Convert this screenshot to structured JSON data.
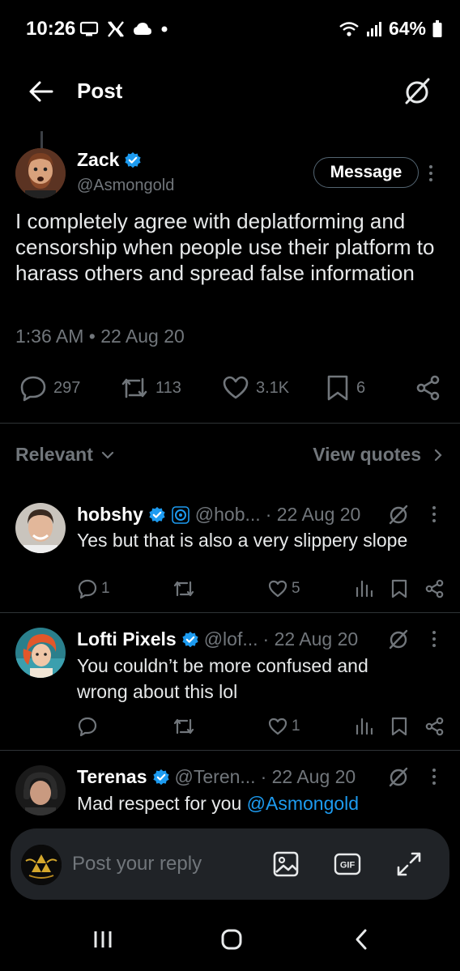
{
  "status_bar": {
    "time": "10:26",
    "battery": "64%",
    "left_icons": [
      "screen-icon",
      "x-icon",
      "cloud-icon",
      "dot-icon"
    ],
    "right_icons": [
      "wifi-icon",
      "signal-icon",
      "battery-icon"
    ]
  },
  "header": {
    "title": "Post",
    "back_icon": "arrow-left-icon",
    "grok_icon": "grok-icon"
  },
  "main_post": {
    "author_name": "Zack",
    "author_handle": "@Asmongold",
    "verified": true,
    "message_button": "Message",
    "text": "I completely agree with deplatforming and censorship when people use their platform to harass others and spread false information",
    "timestamp": "1:36 AM • 22 Aug 20",
    "stats": {
      "replies": "297",
      "reposts": "113",
      "likes": "3.1K",
      "bookmarks": "6"
    }
  },
  "filter": {
    "sort_label": "Relevant",
    "view_quotes_label": "View quotes"
  },
  "replies": [
    {
      "name": "hobshy",
      "handle": "@hob...",
      "date": "· 22 Aug 20",
      "text": "Yes but that is also a very slippery slope",
      "reply_count": "1",
      "repost_count": "",
      "like_count": "5"
    },
    {
      "name": "Lofti Pixels",
      "handle": "@lof...",
      "date": "· 22 Aug 20",
      "text": "You couldn’t be more confused and wrong about this lol",
      "reply_count": "",
      "repost_count": "",
      "like_count": "1"
    },
    {
      "name": "Terenas",
      "handle": "@Teren...",
      "date": "· 22 Aug 20",
      "text": "Mad respect for you ",
      "mention": "@Asmongold"
    }
  ],
  "composer": {
    "placeholder": "Post your reply"
  },
  "colors": {
    "background": "#000000",
    "text": "#e7e9ea",
    "muted": "#71767b",
    "verified_blue": "#1d9bf0",
    "divider": "#2f3336",
    "composer_bg": "#202327"
  }
}
